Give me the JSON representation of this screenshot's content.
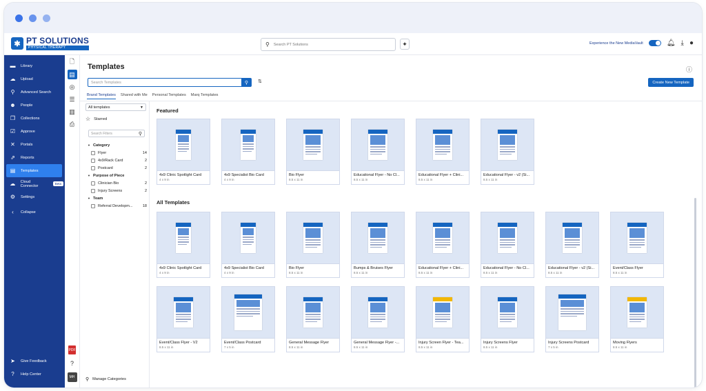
{
  "topbar": {
    "logo_text": "PT SOLUTIONS",
    "logo_sub": "PHYSICAL THERAPY",
    "search_placeholder": "Search PT Solutions",
    "experience_label": "Experience the New MediaVault"
  },
  "sidebar": {
    "items": [
      {
        "label": "Library",
        "icon": "folder-icon"
      },
      {
        "label": "Upload",
        "icon": "cloud-upload-icon"
      },
      {
        "label": "Advanced Search",
        "icon": "search-icon"
      },
      {
        "label": "People",
        "icon": "people-icon"
      },
      {
        "label": "Collections",
        "icon": "collections-icon"
      },
      {
        "label": "Approve",
        "icon": "check-icon"
      },
      {
        "label": "Portals",
        "icon": "portals-icon"
      },
      {
        "label": "Reports",
        "icon": "reports-icon"
      },
      {
        "label": "Templates",
        "icon": "templates-icon"
      },
      {
        "label": "Cloud Connector",
        "icon": "cloud-icon",
        "badge": "Beta"
      },
      {
        "label": "Settings",
        "icon": "gear-icon"
      },
      {
        "label": "Collapse",
        "icon": "collapse-icon"
      }
    ],
    "bottom": [
      {
        "label": "Give Feedback",
        "icon": "send-icon"
      },
      {
        "label": "Help Center",
        "icon": "help-icon"
      }
    ]
  },
  "rail": {
    "avatar": "MH"
  },
  "main": {
    "title": "Templates",
    "search_placeholder": "Search Templates",
    "create_label": "Create New Template",
    "tabs": [
      "Brand Templates",
      "Shared with Me",
      "Personal Templates",
      "Marq Templates"
    ]
  },
  "filters": {
    "select_value": "All templates",
    "starred": "Starred",
    "search_placeholder": "Search Filters",
    "groups": [
      {
        "title": "Category",
        "rows": [
          {
            "label": "Flyer",
            "count": "14"
          },
          {
            "label": "4x9/Rack Card",
            "count": "2"
          },
          {
            "label": "Postcard",
            "count": "2"
          }
        ]
      },
      {
        "title": "Purpose of Piece",
        "rows": [
          {
            "label": "Clinician Bio",
            "count": "2"
          },
          {
            "label": "Injury Screens",
            "count": "2"
          }
        ]
      },
      {
        "title": "Team",
        "rows": [
          {
            "label": "Referral Developm...",
            "count": "18"
          }
        ]
      }
    ],
    "manage": "Manage Categories"
  },
  "featured": {
    "title": "Featured",
    "cards": [
      {
        "name": "4x9 Clinic Spotlight Card",
        "size": "4 x 9 in"
      },
      {
        "name": "4x9 Specialist Bio Card",
        "size": "4 x 9 in"
      },
      {
        "name": "Bio Flyer",
        "size": "8.5 x 11 in"
      },
      {
        "name": "Educational Flyer - No Cl...",
        "size": "8.5 x 11 in"
      },
      {
        "name": "Educational Flyer + Clini...",
        "size": "8.5 x 11 in"
      },
      {
        "name": "Educational Flyer - v2 (Si...",
        "size": "8.5 x 11 in"
      }
    ]
  },
  "all": {
    "title": "All Templates",
    "cards": [
      {
        "name": "4x9 Clinic Spotlight Card",
        "size": "4 x 9 in"
      },
      {
        "name": "4x9 Specialist Bio Card",
        "size": "4 x 9 in"
      },
      {
        "name": "Bio Flyer",
        "size": "8.5 x 11 in"
      },
      {
        "name": "Bumps & Bruises Flyer",
        "size": "8.5 x 11 in"
      },
      {
        "name": "Educational Flyer + Clini...",
        "size": "8.5 x 11 in"
      },
      {
        "name": "Educational Flyer - No Cl...",
        "size": "8.5 x 11 in"
      },
      {
        "name": "Educational Flyer - v2 (Si...",
        "size": "8.5 x 11 in"
      },
      {
        "name": "Event/Class Flyer",
        "size": "8.5 x 11 in"
      },
      {
        "name": "Event/Class Flyer - V2",
        "size": "8.5 x 11 in"
      },
      {
        "name": "Event/Class Postcard",
        "size": "7 x 5 in"
      },
      {
        "name": "General Message Flyer",
        "size": "8.5 x 11 in"
      },
      {
        "name": "General Message Flyer -...",
        "size": "8.5 x 11 in"
      },
      {
        "name": "Injury Screen Flyer - Tea...",
        "size": "8.5 x 11 in"
      },
      {
        "name": "Injury Screens Flyer",
        "size": "8.5 x 11 in"
      },
      {
        "name": "Injury Screens Postcard",
        "size": "7 x 5 in"
      },
      {
        "name": "Moving Flyers",
        "size": "8.5 x 11 in"
      }
    ]
  }
}
